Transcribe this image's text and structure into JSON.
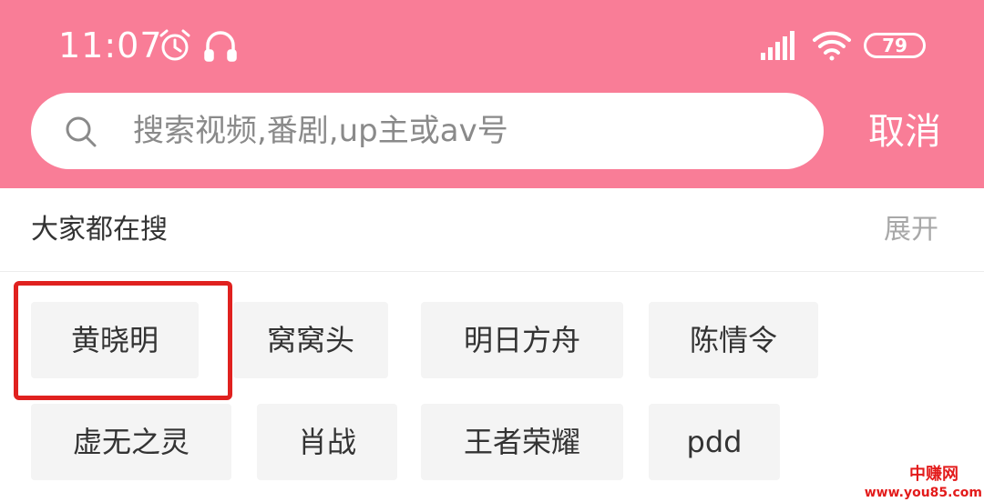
{
  "status_bar": {
    "time": "11:07",
    "battery_level": "79",
    "icons": [
      "alarm-icon",
      "headset-icon",
      "signal-icon",
      "wifi-icon",
      "battery-icon"
    ]
  },
  "search": {
    "placeholder": "搜索视频,番剧,up主或av号",
    "value": "",
    "cancel_label": "取消"
  },
  "hot_search": {
    "title": "大家都在搜",
    "expand_label": "展开",
    "tags": [
      {
        "label": "黄晓明",
        "highlighted": true
      },
      {
        "label": "窝窝头"
      },
      {
        "label": "明日方舟"
      },
      {
        "label": "陈情令"
      },
      {
        "label": "虚无之灵"
      },
      {
        "label": "肖战"
      },
      {
        "label": "王者荣耀"
      },
      {
        "label": "pdd"
      }
    ]
  },
  "watermark": {
    "logo": "中赚网",
    "url": "www.you85.com"
  },
  "colors": {
    "header_pink": "#f97d97",
    "highlight_red": "#e0211f",
    "tag_background": "#f4f4f4"
  }
}
